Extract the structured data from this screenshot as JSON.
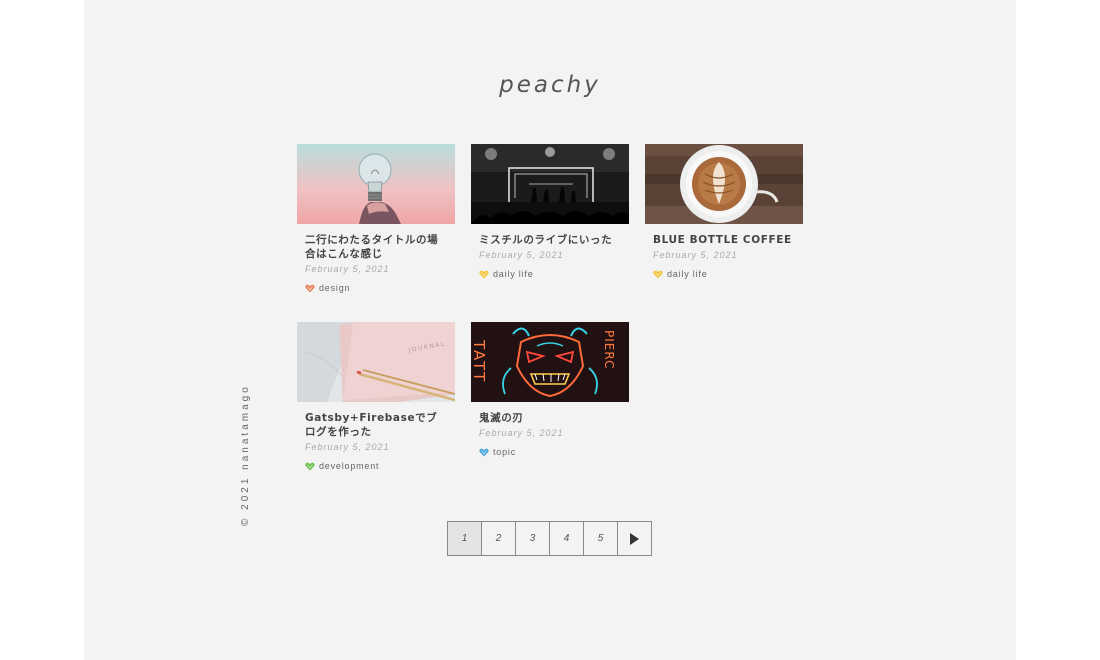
{
  "site": {
    "title": "peachy"
  },
  "footer": {
    "copyright": "© 2021  nanatamago"
  },
  "posts": [
    {
      "title": "二行にわたるタイトルの場合はこんな感じ",
      "date": "February 5, 2021",
      "tag": "design",
      "tag_color": "#e8845f",
      "thumb_icon": "lightbulb-image"
    },
    {
      "title": "ミスチルのライブにいった",
      "date": "February 5, 2021",
      "tag": "daily life",
      "tag_color": "#f2c53d",
      "thumb_icon": "concert-image"
    },
    {
      "title": "BLUE BOTTLE COFFEE",
      "date": "February 5, 2021",
      "tag": "daily life",
      "tag_color": "#f2c53d",
      "thumb_icon": "latte-image"
    },
    {
      "title": "Gatsby+Firebaseでブログを作った",
      "date": "February 5, 2021",
      "tag": "development",
      "tag_color": "#6cc04a",
      "thumb_icon": "journal-image"
    },
    {
      "title": "鬼滅の刃",
      "date": "February 5, 2021",
      "tag": "topic",
      "tag_color": "#4aa8e0",
      "thumb_icon": "neon-sign-image"
    }
  ],
  "thumbnail_text": {
    "journal": "JOURNAL",
    "neon_left": "TATT",
    "neon_right": "PIERC"
  },
  "pagination": {
    "pages": [
      "1",
      "2",
      "3",
      "4",
      "5"
    ],
    "current": "1",
    "next_icon": "play-arrow-icon"
  }
}
